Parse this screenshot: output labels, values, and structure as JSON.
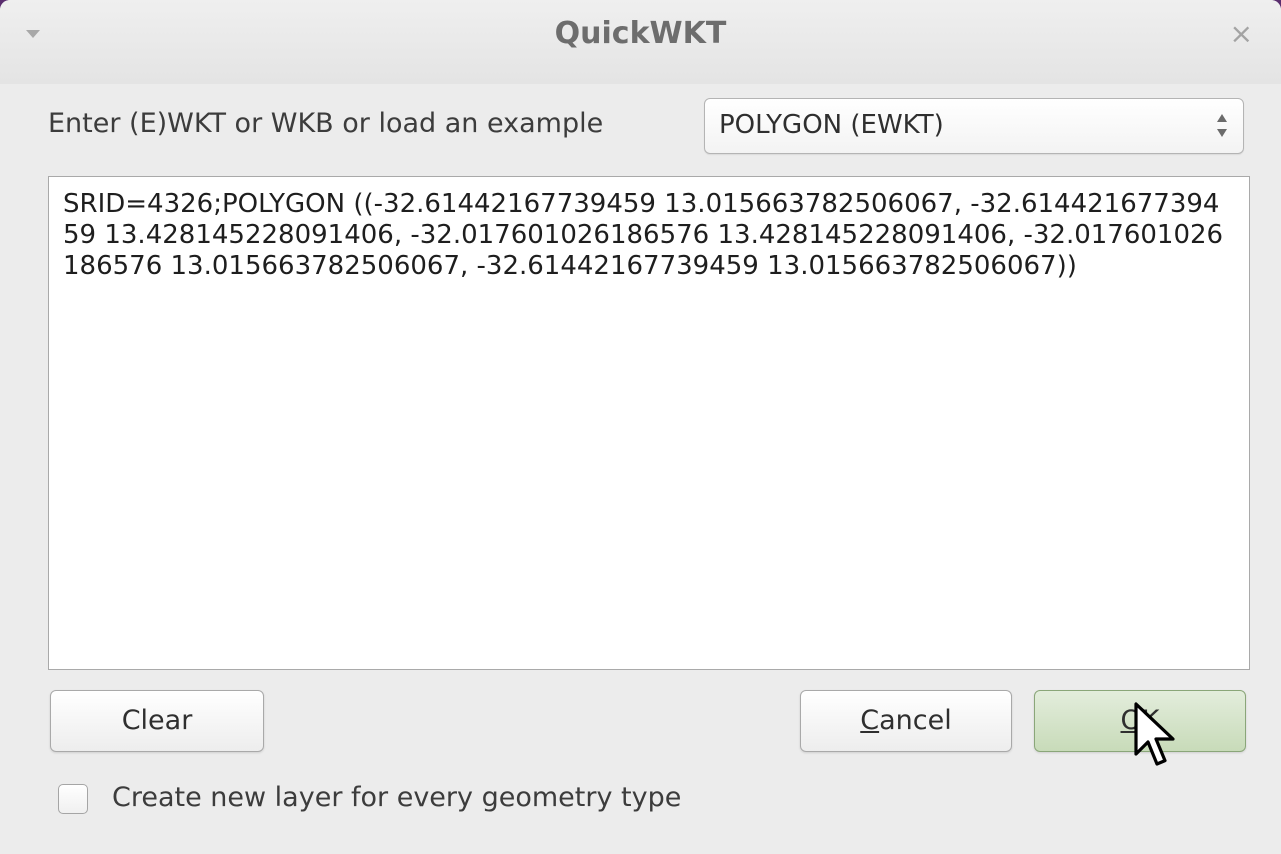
{
  "window": {
    "title": "QuickWKT",
    "close_glyph": "×"
  },
  "input": {
    "prompt_label": "Enter (E)WKT or WKB or load an example",
    "example_selected": "POLYGON (EWKT)",
    "wkt_text": "SRID=4326;POLYGON ((-32.61442167739459 13.015663782506067, -32.61442167739459 13.428145228091406, -32.017601026186576 13.428145228091406, -32.017601026186576 13.015663782506067, -32.61442167739459 13.015663782506067))"
  },
  "buttons": {
    "clear": "Clear",
    "cancel_mnemonic": "C",
    "cancel_rest": "ancel",
    "ok_mnemonic": "O",
    "ok_rest": "K"
  },
  "options": {
    "new_layer_label": "Create new layer for every geometry type",
    "new_layer_checked": false
  },
  "icons": {
    "menu": "window-menu-icon",
    "close": "close-icon",
    "combo": "spin-arrows-icon",
    "cursor": "mouse-pointer-icon"
  },
  "colors": {
    "ok_button": "#c8dbb9",
    "background": "#ececec"
  }
}
